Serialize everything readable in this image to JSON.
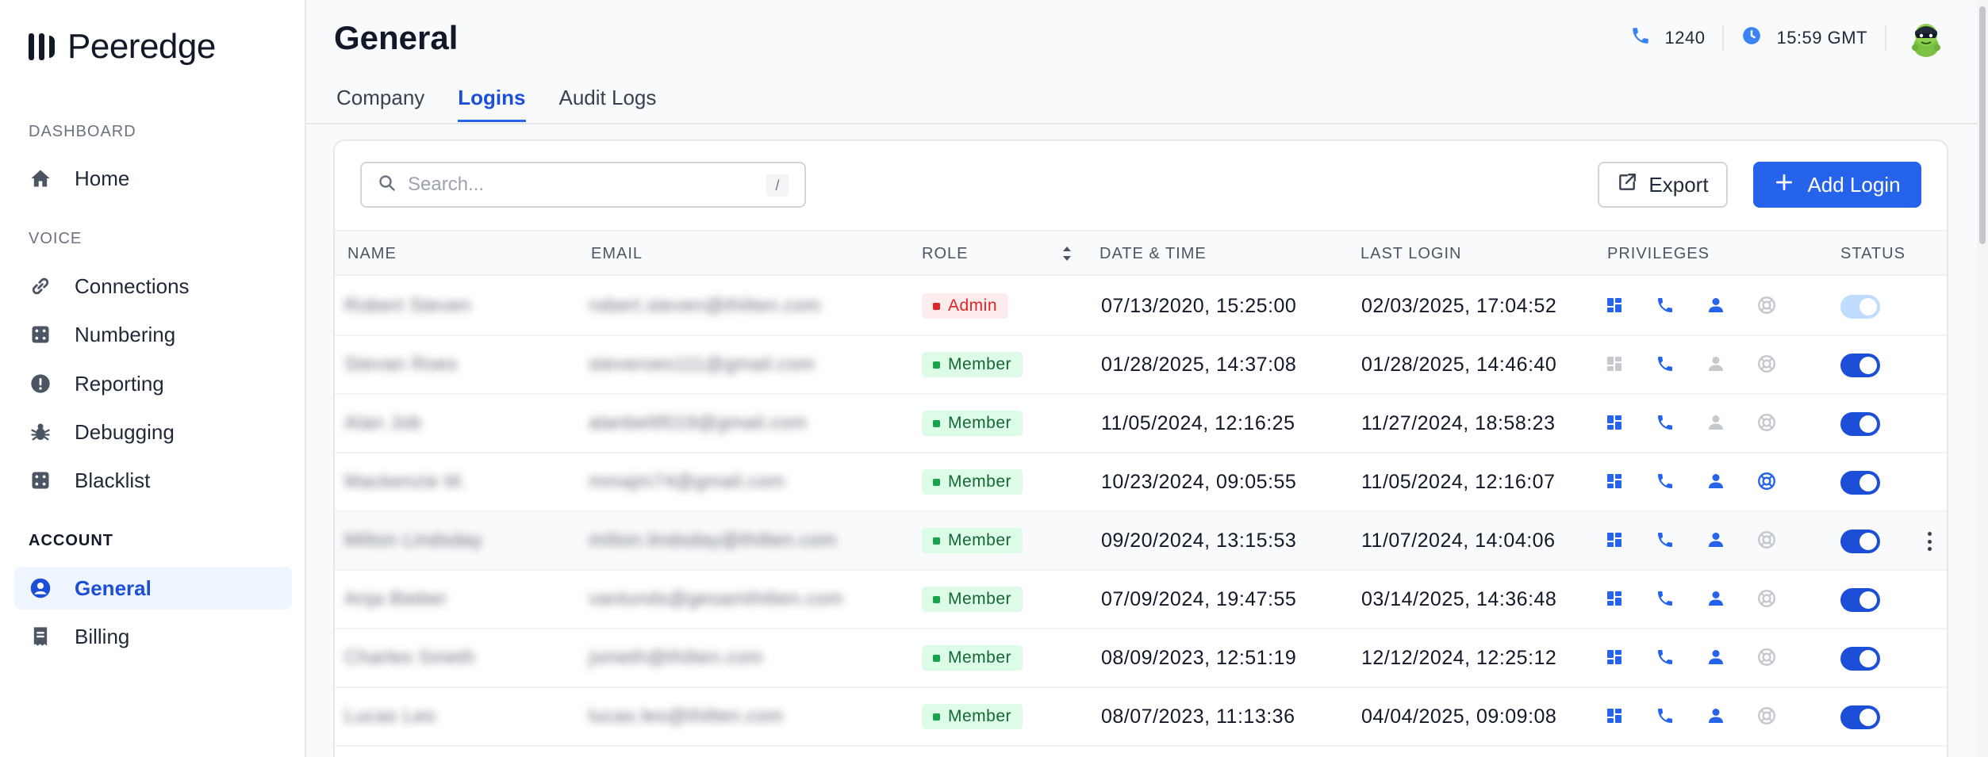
{
  "app": {
    "brand": "Peeredge"
  },
  "sidebar": {
    "sections": [
      {
        "title": "DASHBOARD",
        "items": [
          {
            "label": "Home",
            "icon": "home-icon"
          }
        ]
      },
      {
        "title": "VOICE",
        "items": [
          {
            "label": "Connections",
            "icon": "link-icon"
          },
          {
            "label": "Numbering",
            "icon": "dice-icon"
          },
          {
            "label": "Reporting",
            "icon": "alert-circle-icon"
          },
          {
            "label": "Debugging",
            "icon": "bug-icon"
          },
          {
            "label": "Blacklist",
            "icon": "dice-icon"
          }
        ]
      },
      {
        "title": "ACCOUNT",
        "items": [
          {
            "label": "General",
            "icon": "user-circle-icon",
            "active": true
          },
          {
            "label": "Billing",
            "icon": "receipt-icon"
          }
        ]
      }
    ]
  },
  "header": {
    "title": "General",
    "extension": "1240",
    "time": "15:59 GMT"
  },
  "tabs": [
    {
      "label": "Company"
    },
    {
      "label": "Logins",
      "active": true
    },
    {
      "label": "Audit Logs"
    }
  ],
  "toolbar": {
    "search_placeholder": "Search...",
    "search_shortcut": "/",
    "export_label": "Export",
    "add_label": "Add Login"
  },
  "table": {
    "columns": [
      "NAME",
      "EMAIL",
      "ROLE",
      "DATE & TIME",
      "LAST LOGIN",
      "PRIVILEGES",
      "STATUS"
    ],
    "rows": [
      {
        "name": "Robert Steven",
        "email": "robert.steven@thilten.com",
        "role": "Admin",
        "date_time": "07/13/2020, 15:25:00",
        "last_login": "02/03/2025, 17:04:52",
        "privileges": [
          true,
          true,
          true,
          false
        ],
        "status": "pending"
      },
      {
        "name": "Stevan Roes",
        "email": "steveroes111@gmail.com",
        "role": "Member",
        "date_time": "01/28/2025, 14:37:08",
        "last_login": "01/28/2025, 14:46:40",
        "privileges": [
          false,
          true,
          false,
          false
        ],
        "status": "on"
      },
      {
        "name": "Alan Job",
        "email": "alanbeltf019@gmail.com",
        "role": "Member",
        "date_time": "11/05/2024, 12:16:25",
        "last_login": "11/27/2024, 18:58:23",
        "privileges": [
          true,
          true,
          false,
          false
        ],
        "status": "on"
      },
      {
        "name": "Mackenzie M.",
        "email": "mmajm74@gmail.com",
        "role": "Member",
        "date_time": "10/23/2024, 09:05:55",
        "last_login": "11/05/2024, 12:16:07",
        "privileges": [
          true,
          true,
          true,
          true
        ],
        "status": "on"
      },
      {
        "name": "Milton Lindsday",
        "email": "milton.lindsday@thilten.com",
        "role": "Member",
        "date_time": "09/20/2024, 13:15:53",
        "last_login": "11/07/2024, 14:04:06",
        "privileges": [
          true,
          true,
          true,
          false
        ],
        "status": "on",
        "hover": true
      },
      {
        "name": "Anja Bieber",
        "email": "vanlunds@gesamthilten.com",
        "role": "Member",
        "date_time": "07/09/2024, 19:47:55",
        "last_login": "03/14/2025, 14:36:48",
        "privileges": [
          true,
          true,
          true,
          false
        ],
        "status": "on"
      },
      {
        "name": "Charles Smeth",
        "email": "jsmeth@thilten.com",
        "role": "Member",
        "date_time": "08/09/2023, 12:51:19",
        "last_login": "12/12/2024, 12:25:12",
        "privileges": [
          true,
          true,
          true,
          false
        ],
        "status": "on"
      },
      {
        "name": "Lucas Leo",
        "email": "lucas.leo@thilten.com",
        "role": "Member",
        "date_time": "08/07/2023, 11:13:36",
        "last_login": "04/04/2025, 09:09:08",
        "privileges": [
          true,
          true,
          true,
          false
        ],
        "status": "on"
      }
    ]
  },
  "colors": {
    "accent": "#2563eb",
    "admin": "#dc2626",
    "member": "#16a34a",
    "muted_icon": "#c4c8cf"
  }
}
